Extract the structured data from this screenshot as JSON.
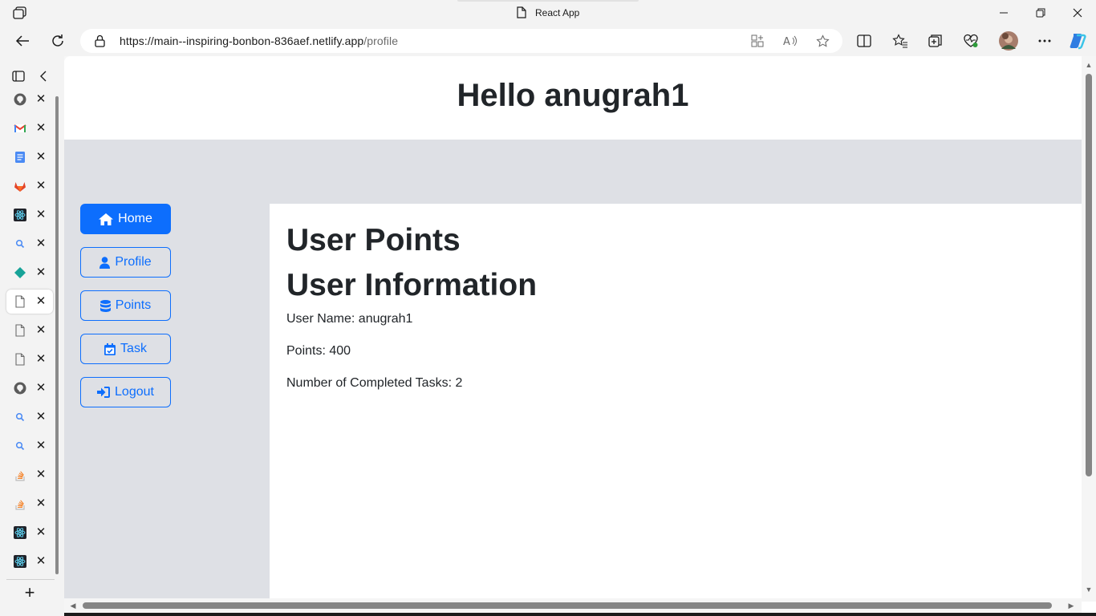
{
  "browser": {
    "tab_title": "React App",
    "url_host": "https://main--inspiring-bonbon-836aef.netlify.app",
    "url_path": "/profile",
    "accent": "#0d6efd"
  },
  "vertical_tabs": [
    {
      "icon": "github-icon"
    },
    {
      "icon": "gmail-icon"
    },
    {
      "icon": "docs-icon"
    },
    {
      "icon": "gitlab-icon"
    },
    {
      "icon": "react-icon"
    },
    {
      "icon": "search-icon"
    },
    {
      "icon": "diamond-icon"
    },
    {
      "icon": "page-icon",
      "active": true
    },
    {
      "icon": "page-icon"
    },
    {
      "icon": "page-icon"
    },
    {
      "icon": "github-icon"
    },
    {
      "icon": "search-icon"
    },
    {
      "icon": "search-icon"
    },
    {
      "icon": "stackoverflow-icon"
    },
    {
      "icon": "stackoverflow-icon"
    },
    {
      "icon": "react-icon"
    },
    {
      "icon": "react-icon"
    }
  ],
  "page": {
    "greeting": "Hello anugrah1",
    "nav": {
      "home": "Home",
      "profile": "Profile",
      "points": "Points",
      "task": "Task",
      "logout": "Logout"
    },
    "content": {
      "heading_points": "User Points",
      "heading_info": "User Information",
      "user_name": "User Name: anugrah1",
      "points": "Points: 400",
      "completed_tasks": "Number of Completed Tasks: 2"
    }
  }
}
